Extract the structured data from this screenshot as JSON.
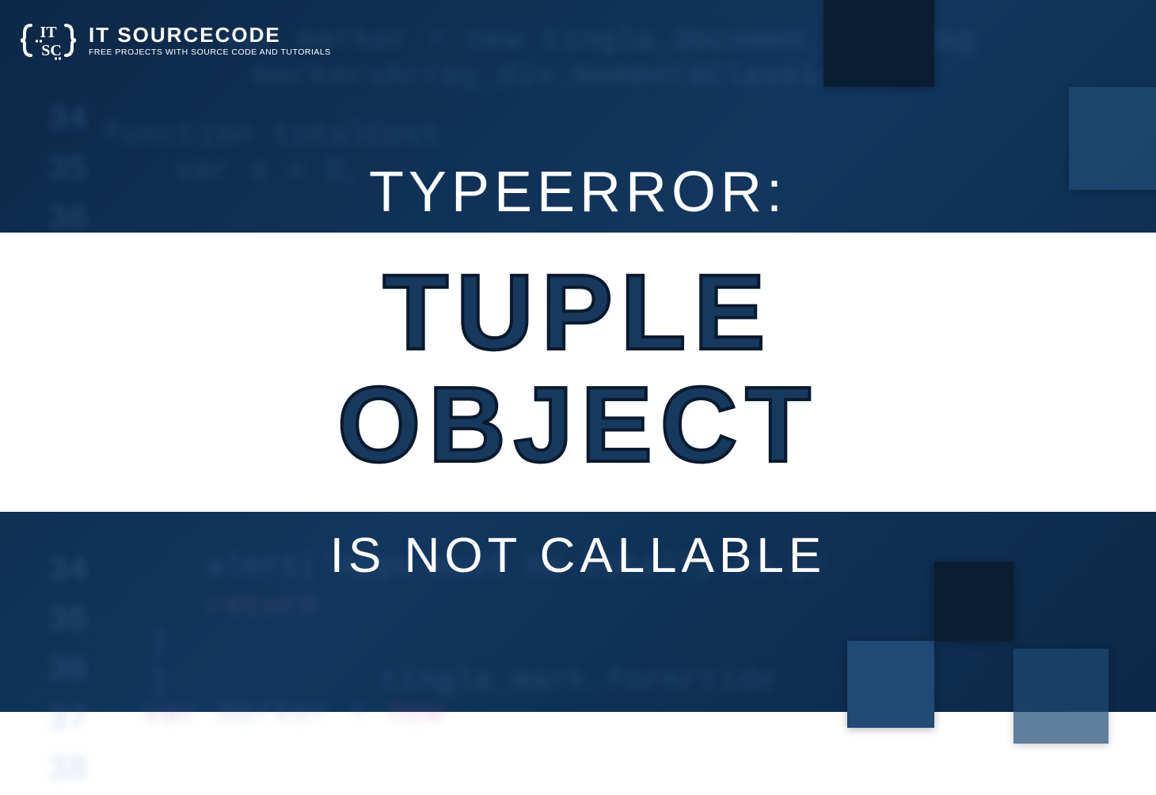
{
  "logo": {
    "title": "IT SOURCECODE",
    "subtitle": "FREE PROJECTS WITH SOURCE CODE AND TUTORIALS"
  },
  "heading": {
    "top": "TYPEERROR:",
    "line1": "TUPLE",
    "line2": "OBJECT",
    "bottom": "IS NOT CALLABLE"
  }
}
